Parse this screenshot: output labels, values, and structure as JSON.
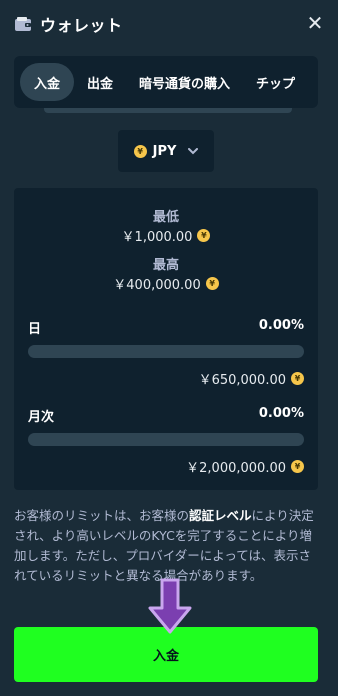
{
  "header": {
    "title": "ウォレット",
    "close_symbol": "✕"
  },
  "tabs": [
    {
      "label": "入金",
      "active": true
    },
    {
      "label": "出金",
      "active": false
    },
    {
      "label": "暗号通貨の購入",
      "active": false
    },
    {
      "label": "チップ",
      "active": false
    }
  ],
  "currency": {
    "symbol": "¥",
    "code": "JPY"
  },
  "limits": {
    "min_label": "最低",
    "min_value": "￥1,000.00",
    "max_label": "最高",
    "max_value": "￥400,000.00",
    "daily": {
      "label": "日",
      "percent": "0.00%",
      "fill": 0,
      "amount": "￥650,000.00"
    },
    "monthly": {
      "label": "月次",
      "percent": "0.00%",
      "fill": 0,
      "amount": "￥2,000,000.00"
    }
  },
  "notice": {
    "part1": "お客様のリミットは、お客様の",
    "bold": "認証レベル",
    "part2": "により決定され、より高いレベルのKYCを完了することにより増加します。ただし、プロバイダーによっては、表示されているリミットと異なる場合があります。"
  },
  "deposit_button": {
    "label": "入金"
  },
  "colors": {
    "background": "#1a2c38",
    "panel": "#0f212e",
    "track": "#2f4553",
    "accent_green": "#1fff20",
    "coin": "#f6c64b",
    "arrow": "#7b3fb0"
  }
}
